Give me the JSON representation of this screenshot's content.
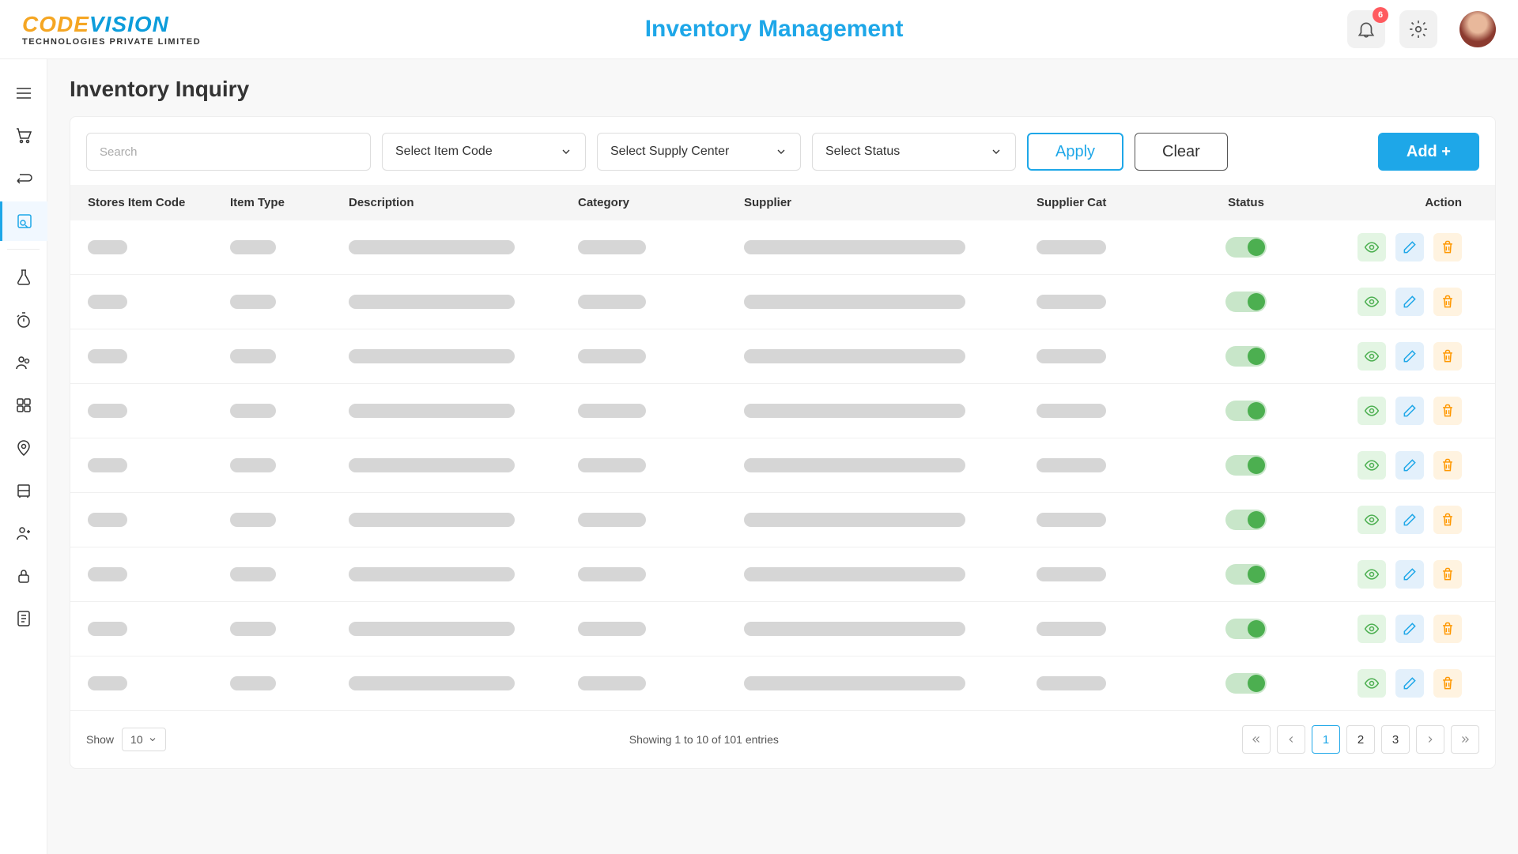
{
  "header": {
    "logo_part1": "CODE",
    "logo_part2": "VISION",
    "logo_sub": "TECHNOLOGIES PRIVATE LIMITED",
    "title": "Inventory Management",
    "notification_count": "6"
  },
  "page": {
    "title": "Inventory Inquiry"
  },
  "filters": {
    "search_placeholder": "Search",
    "item_code_label": "Select Item Code",
    "supply_center_label": "Select Supply Center",
    "status_label": "Select Status",
    "apply_label": "Apply",
    "clear_label": "Clear",
    "add_label": "Add +"
  },
  "table": {
    "columns": {
      "code": "Stores Item Code",
      "type": "Item Type",
      "desc": "Description",
      "cat": "Category",
      "supp": "Supplier",
      "scat": "Supplier Cat",
      "status": "Status",
      "action": "Action"
    },
    "row_count": 9
  },
  "footer": {
    "show_label": "Show",
    "page_size": "10",
    "summary": "Showing 1 to 10  of 101 entries",
    "pages": [
      "1",
      "2",
      "3"
    ],
    "active_page": "1"
  }
}
